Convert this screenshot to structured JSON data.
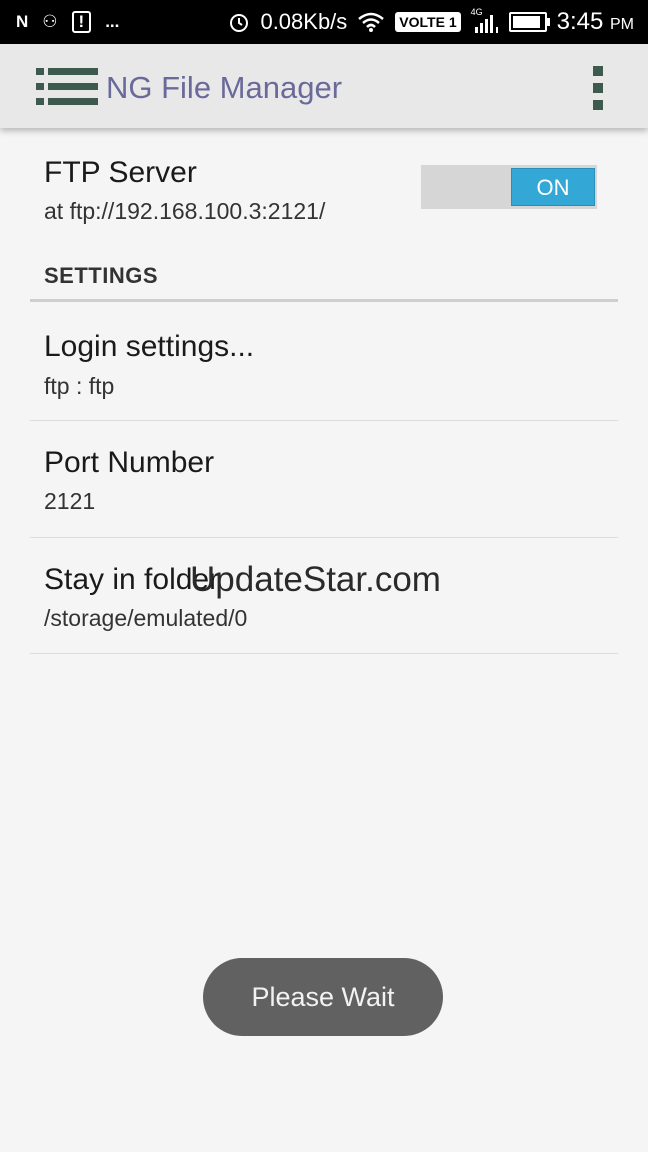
{
  "status_bar": {
    "left_icons": [
      "N",
      "⚇",
      "!",
      "..."
    ],
    "network_speed": "0.08Kb/s",
    "volte": "VOLTE 1",
    "signal_label": "4G",
    "battery_level": 0.9,
    "time": "3:45",
    "ampm": "PM"
  },
  "app_bar": {
    "title": "NG File Manager",
    "menu_icon": "hamburger-list-icon",
    "overflow_icon": "more-vert-icon"
  },
  "ftp": {
    "title": "FTP Server",
    "address": "at ftp://192.168.100.3:2121/",
    "toggle_label": "ON"
  },
  "settings": {
    "header": "SETTINGS",
    "items": [
      {
        "title": "Login settings...",
        "subtitle": "ftp : ftp"
      },
      {
        "title": "Port Number",
        "subtitle": "2121"
      },
      {
        "title": "Stay in folder",
        "subtitle": "/storage/emulated/0"
      }
    ]
  },
  "watermark": "UpdateStar.com",
  "toast": "Please Wait",
  "colors": {
    "toggle_on": "#33a8d6",
    "title_text": "#6a6a9a",
    "toast_bg": "#616161"
  }
}
